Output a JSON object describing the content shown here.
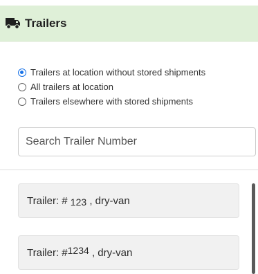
{
  "panel": {
    "title": "Trailers",
    "icon": "truck-icon",
    "header_color": "#dff0d8"
  },
  "filters": {
    "options": [
      {
        "label": "Trailers at location without stored shipments",
        "checked": true
      },
      {
        "label": "All trailers at location",
        "checked": false
      },
      {
        "label": "Trailers elsewhere with stored shipments",
        "checked": false
      }
    ],
    "accent_color": "#1a73e8"
  },
  "search": {
    "placeholder": "Search Trailer Number",
    "value": ""
  },
  "trailers": [
    {
      "prefix": "Trailer: #",
      "number": "123",
      "type": ", dry-van"
    },
    {
      "prefix": "Trailer: #",
      "number": "1234",
      "type": ", dry-van"
    }
  ]
}
